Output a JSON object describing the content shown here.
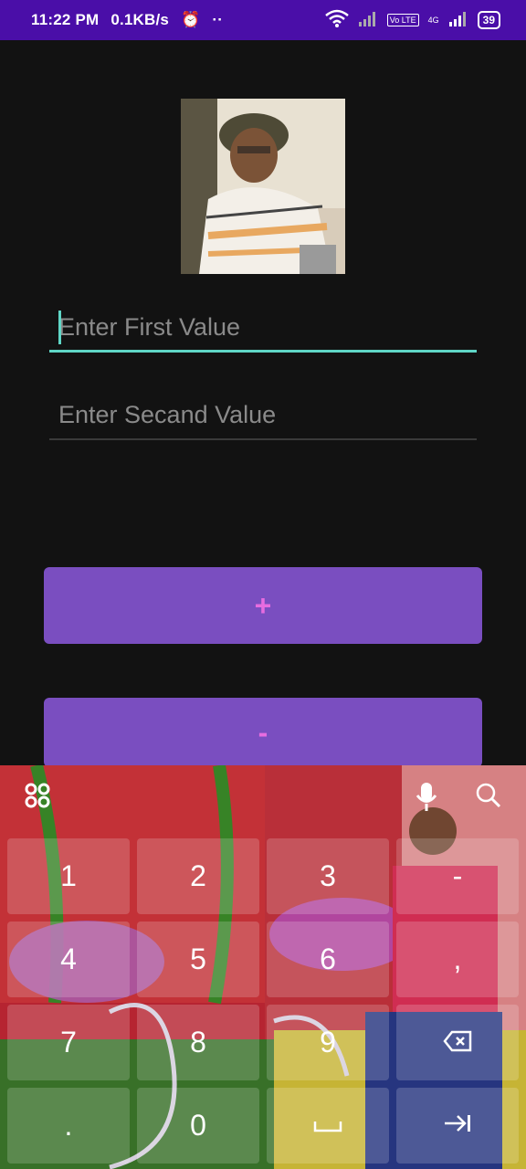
{
  "status_bar": {
    "time": "11:22 PM",
    "speed": "0.1KB/s",
    "more": "··",
    "volte": "Vo LTE",
    "network": "4G",
    "battery": "39"
  },
  "form": {
    "first_placeholder": "Enter First Value",
    "first_value": "",
    "second_placeholder": "Enter Secand Value",
    "second_value": ""
  },
  "buttons": {
    "add_label": "+",
    "subtract_label": "-"
  },
  "keyboard": {
    "icons": {
      "left": "apps-icon",
      "mic": "mic-icon",
      "search": "search-icon"
    },
    "keys": [
      "1",
      "2",
      "3",
      "-",
      "4",
      "5",
      "6",
      ",",
      "7",
      "8",
      "9",
      "backspace",
      ".",
      "0",
      "space",
      "next"
    ]
  },
  "colors": {
    "status_bar": "#4a0ea8",
    "background": "#121212",
    "accent": "#5fd6c6",
    "button": "#7a4ec0",
    "button_text": "#e76ce0"
  }
}
